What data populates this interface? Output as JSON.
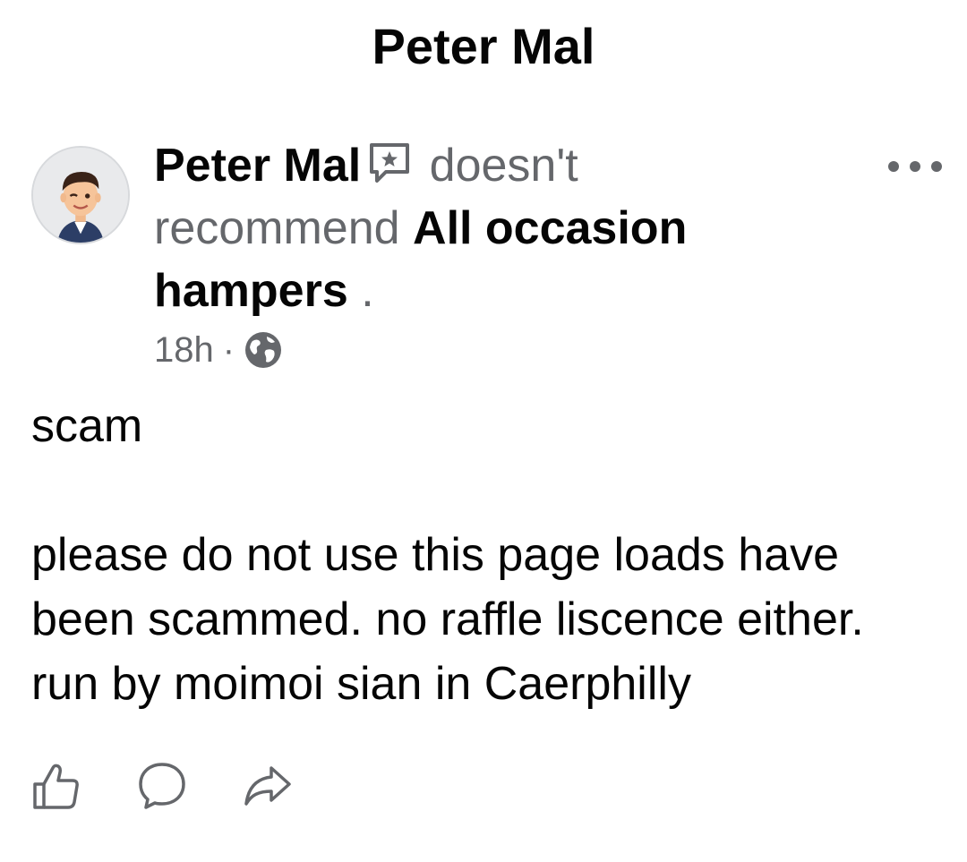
{
  "header": {
    "title": "Peter Mal"
  },
  "post": {
    "author": "Peter Mal",
    "verb": "doesn't recommend",
    "page_name": "All occasion hampers",
    "end_punct": ".",
    "time": "18h",
    "separator": "·",
    "audience_icon": "globe-icon",
    "review_icon": "review-star-icon",
    "more_icon": "more-options-icon",
    "body_line1": "scam",
    "body_line2": "please do not use this page loads have been scammed. no raffle liscence either. run by moimoi sian in Caerphilly"
  },
  "actions": {
    "like_icon": "like-icon",
    "comment_icon": "comment-icon",
    "share_icon": "share-icon"
  },
  "colors": {
    "primary_text": "#050505",
    "secondary_text": "#65676b",
    "icon_gray": "#65676b"
  }
}
